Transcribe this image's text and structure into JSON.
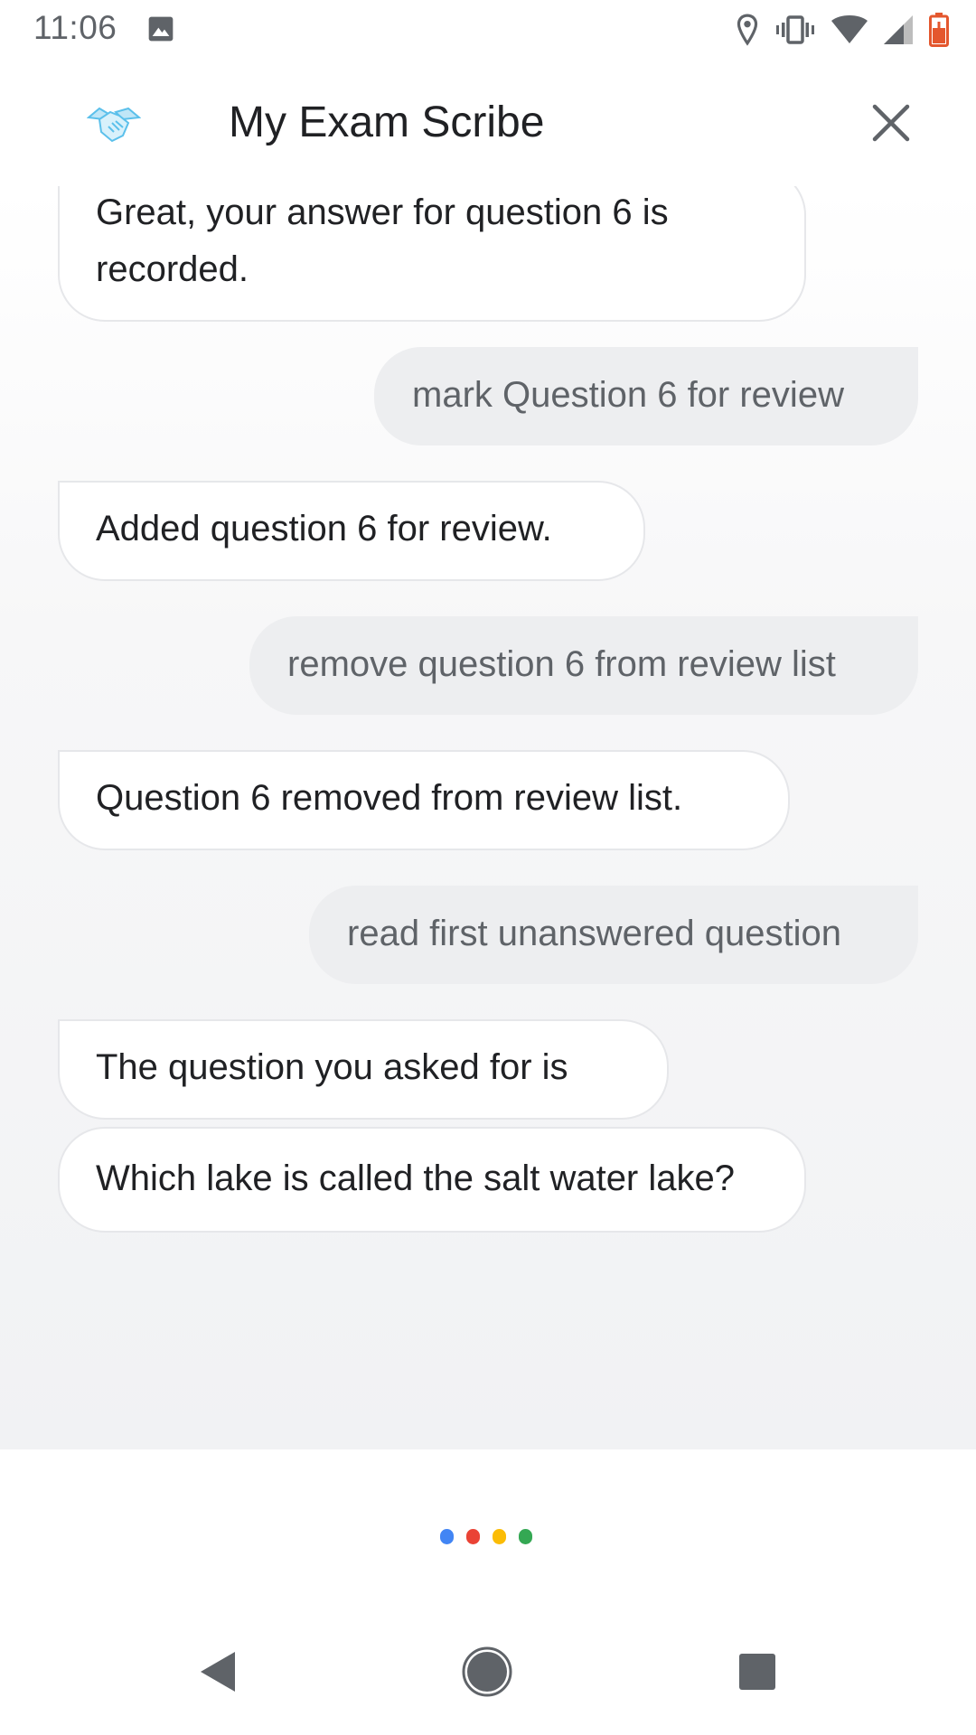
{
  "status_bar": {
    "time": "11:06",
    "icons": [
      "image-icon",
      "location-icon",
      "vibrate-icon",
      "wifi-icon",
      "signal-icon",
      "battery-icon"
    ]
  },
  "header": {
    "title": "My Exam Scribe",
    "logo_icon": "handshake-icon",
    "close_icon": "close-icon"
  },
  "messages": [
    {
      "role": "assistant",
      "text": "Great, your answer for question 6 is recorded."
    },
    {
      "role": "user",
      "text": "mark Question 6 for review"
    },
    {
      "role": "assistant",
      "text": "Added question 6 for review."
    },
    {
      "role": "user",
      "text": "remove question 6 from review list"
    },
    {
      "role": "assistant",
      "text": "Question 6 removed from review list."
    },
    {
      "role": "user",
      "text": "read first unanswered question"
    },
    {
      "role": "assistant",
      "text": "The question you asked for is"
    },
    {
      "role": "assistant",
      "text": "Which lake is called the salt water lake?"
    }
  ],
  "assistant_indicator": {
    "colors": [
      "#4285F4",
      "#EA4335",
      "#FBBC05",
      "#34A853"
    ]
  },
  "nav": {
    "back_icon": "back-triangle-icon",
    "home_icon": "home-circle-icon",
    "recents_icon": "recents-square-icon"
  }
}
